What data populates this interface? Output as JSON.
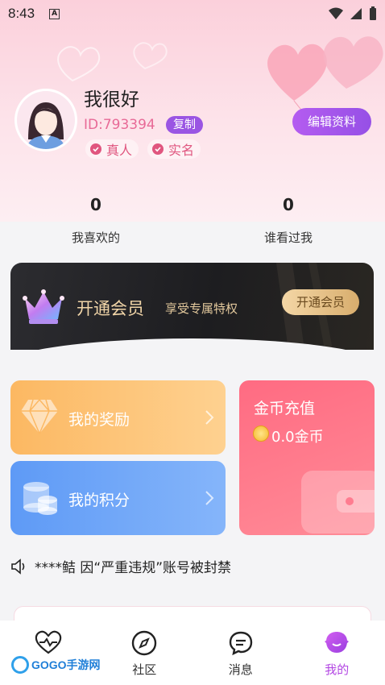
{
  "status_bar": {
    "time": "8:43",
    "a_icon": "A"
  },
  "profile": {
    "nickname": "我很好",
    "id_text": "ID:793394",
    "copy_label": "复制",
    "tags": [
      "真人",
      "实名"
    ],
    "edit_label": "编辑资料"
  },
  "stats": [
    {
      "value": "0",
      "label": "我喜欢的"
    },
    {
      "value": "0",
      "label": "谁看过我"
    }
  ],
  "vip": {
    "title": "开通会员",
    "subtitle": "享受专属特权",
    "button": "开通会员"
  },
  "cards": {
    "reward": "我的奖励",
    "points": "我的积分",
    "coin_title": "金币充值",
    "coin_amount": "0.0金币"
  },
  "notice": "****鲒 因“严重违规”账号被封禁",
  "tabs": [
    {
      "label": "",
      "icon": "heart-pulse-icon"
    },
    {
      "label": "社区",
      "icon": "compass-icon"
    },
    {
      "label": "消息",
      "icon": "chat-bubble-icon"
    },
    {
      "label": "我的",
      "icon": "profile-face-icon"
    }
  ],
  "watermark": "GOGO手游网",
  "colors": {
    "accent": "#9a55e3",
    "pink": "#e86a97",
    "active_tab": "#b347e3"
  }
}
